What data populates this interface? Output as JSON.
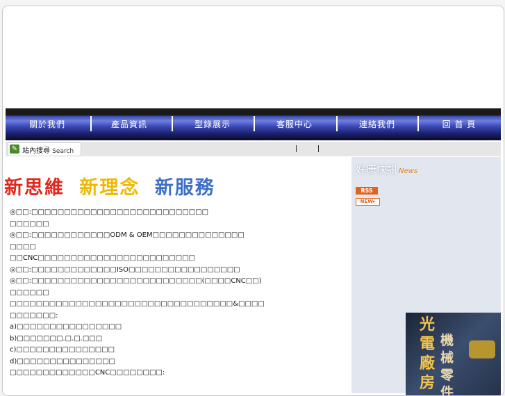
{
  "nav": {
    "items": [
      "關於我們",
      "產品資訊",
      "型錄展示",
      "客服中心",
      "連絡我們",
      "回 首 頁"
    ]
  },
  "search": {
    "label_cn": "站內搜尋",
    "label_en": "Search"
  },
  "headline": {
    "part1": "新思維",
    "part2": "新理念",
    "part3": "新服務",
    "color1": "#e0281c",
    "color2": "#f0b800",
    "color3": "#3d6fc8"
  },
  "content": {
    "lines": [
      "◎□□:□□□□□□□□□□□□□□□□□□□□□□□□□□□",
      "□□□□□□",
      "◎□□:□□□□□□□□□□□□ODM & OEM□□□□□□□□□□□□□□",
      "□□□□",
      "□□CNC□□□□□□□□□□□□□□□□□□□□□□□□",
      "◎□□:□□□□□□□□□□□□□ISO□□□□□□□□□□□□□□□□□",
      "◎□□:□□□□□□□□□□□□□□□□□□□□□□□□□□(□□□□CNC□□)",
      "□□□□□□",
      "□□□□□□□□□□□□□□□□□□□□□□□□□□□□□□□□□□&□□□□",
      "□□□□□□□:",
      "a)□□□□□□□□□□□□□□□□",
      "b)□□□□□□□.□.□.□□□",
      "c)□□□□□□□□□□□□□□□",
      "d)□□□□□□□□□□□□□□□",
      "□□□□□□□□□□□□□CNC□□□□□□□□:"
    ]
  },
  "sidebar": {
    "title": "好康快訊",
    "title_en": "News",
    "rss_label": "RSS",
    "new_label": "NEW▸",
    "ad_text1": "光電廠房",
    "ad_text2": "機械零件"
  }
}
